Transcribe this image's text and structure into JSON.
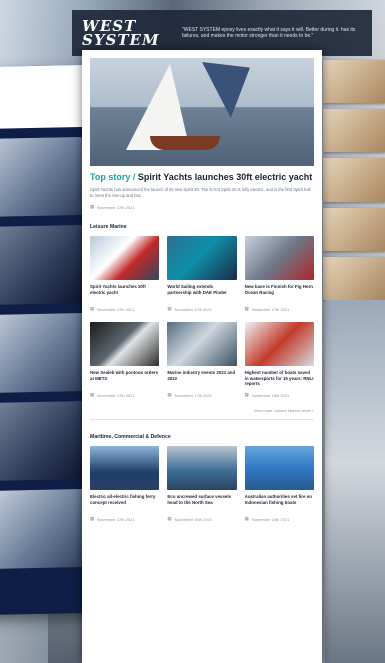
{
  "header": {
    "logo_line1": "WEST",
    "logo_line2": "SYSTEM",
    "quote": "\"WEST SYSTEM epoxy lives exactly what it says it will. Better during it. has its failures, and makes the motor stronger than it needs to be.\"",
    "quote_source": ""
  },
  "top_story": {
    "kicker": "Top story /",
    "title": "Spirit Yachts launches 30ft electric yacht",
    "excerpt": "Spirit Yachts has announced the launch of its new Spirit 30. The 9.7mt Spirit 30 is fully electric, and is the first Spirit hull to meet the rise-up and low...",
    "date": "November 17th 2021"
  },
  "sections": [
    {
      "title": "Leisure Marine",
      "cards": [
        {
          "title": "Spirit Yachts launches 30ft electric yacht",
          "date": "November 17th 2021"
        },
        {
          "title": "World Sailing extends partnership with DAE Pinder",
          "date": "November 17th 2021"
        },
        {
          "title": "New base is Finnish for Fig Horn Ocean Racing",
          "date": "November 17th 2021"
        },
        {
          "title": "New Sealeb with pontoon orders at METS",
          "date": "November 17th 2021"
        },
        {
          "title": "Marine industry events 2021 and 2022",
          "date": "November 17th 2021"
        },
        {
          "title": "Highest number of boats saved in watersports for 15 years: RNLI reports",
          "date": "November 15th 2021"
        }
      ],
      "more_link": "View more Leisure Marine news  >"
    },
    {
      "title": "Maritime, Commercial & Defence",
      "cards": [
        {
          "title": "Electric all-electric fishing ferry concept received",
          "date": "November 17th 2021"
        },
        {
          "title": "Eco uncrewed surface vessels head to the North Sea",
          "date": "November 15th 2021"
        },
        {
          "title": "Australian authorities set fire on Indonesian fishing boats",
          "date": "November 15th 2021"
        }
      ]
    }
  ],
  "icons": {
    "calendar": "calendar-icon"
  },
  "colors": {
    "kicker": "#1aa3a3",
    "header_bg": "#1e283a",
    "text": "#1a2233"
  }
}
